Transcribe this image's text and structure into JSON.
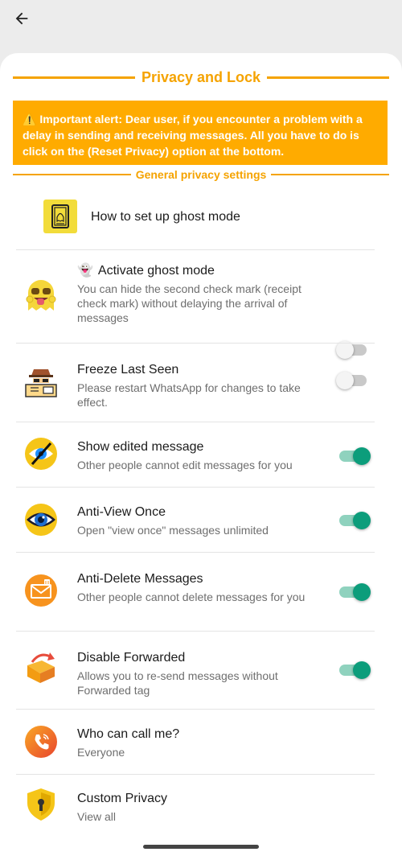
{
  "header": {
    "back_icon": "arrow-left-icon"
  },
  "page": {
    "title": "Privacy and Lock",
    "alert": "⚠️ Important alert: Dear user, if you encounter a problem with a delay in sending and receiving messages. All you have to do is click on the (Reset Privacy) option at the bottom.",
    "section_title": "General privacy settings"
  },
  "items": [
    {
      "title": "How to set up ghost mode",
      "subtitle": "",
      "icon": "ghost-guide-icon"
    },
    {
      "emoji": "👻",
      "title": "Activate ghost mode",
      "subtitle": "You can hide the second check mark (receipt check mark) without delaying the arrival of messages",
      "icon": "ghost-face-icon",
      "toggle": false
    },
    {
      "title": "Freeze Last Seen",
      "subtitle": "Please restart WhatsApp for changes to take effect.",
      "icon": "spy-icon",
      "toggle": false
    },
    {
      "title": "Show edited message",
      "subtitle": "Other people cannot edit messages for you",
      "icon": "eye-slash-icon",
      "toggle": true
    },
    {
      "title": "Anti-View Once",
      "subtitle": "Open \"view once\" messages unlimited",
      "icon": "eye-icon",
      "toggle": true
    },
    {
      "title": "Anti-Delete Messages",
      "subtitle": "Other people cannot delete messages for you",
      "icon": "envelope-delete-icon",
      "toggle": true
    },
    {
      "title": "Disable Forwarded",
      "subtitle": "Allows you to re-send messages without Forwarded tag",
      "icon": "forward-envelope-icon",
      "toggle": true
    },
    {
      "title": "Who can call me?",
      "subtitle": "Everyone",
      "icon": "phone-call-icon"
    },
    {
      "title": "Custom Privacy",
      "subtitle": "View all",
      "icon": "shield-lock-icon"
    }
  ],
  "colors": {
    "accent": "#f5a300",
    "alert_bg": "#ffab00",
    "toggle_on": "#0c9d7b"
  }
}
